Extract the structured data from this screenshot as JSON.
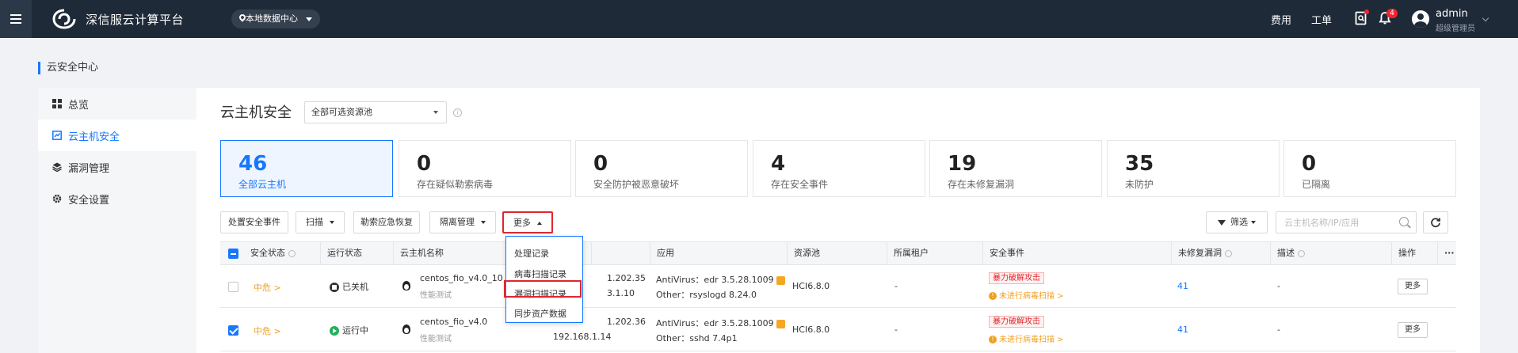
{
  "header": {
    "app_title": "深信服云计算平台",
    "datacenter": "本地数据中心",
    "links": {
      "cost": "费用",
      "ticket": "工单"
    },
    "notification_count": "4",
    "user": {
      "name": "admin",
      "role": "超级管理员"
    }
  },
  "breadcrumb": "云安全中心",
  "sidebar": {
    "items": [
      {
        "label": "总览",
        "icon": "grid-icon"
      },
      {
        "label": "云主机安全",
        "icon": "shield-host-icon",
        "active": true
      },
      {
        "label": "漏洞管理",
        "icon": "layers-icon"
      },
      {
        "label": "安全设置",
        "icon": "gear-icon"
      }
    ]
  },
  "main": {
    "title": "云主机安全",
    "pool_select": "全部可选资源池",
    "info": "i"
  },
  "stats": [
    {
      "value": "46",
      "label": "全部云主机",
      "active": true
    },
    {
      "value": "0",
      "label": "存在疑似勒索病毒"
    },
    {
      "value": "0",
      "label": "安全防护被恶意破坏"
    },
    {
      "value": "4",
      "label": "存在安全事件"
    },
    {
      "value": "19",
      "label": "存在未修复漏洞"
    },
    {
      "value": "35",
      "label": "未防护"
    },
    {
      "value": "0",
      "label": "已隔离"
    }
  ],
  "toolbar": {
    "handle_events": "处置安全事件",
    "scan": "扫描",
    "ransom_recovery": "勒索应急恢复",
    "isolation": "隔离管理",
    "more": "更多",
    "filter": "筛选",
    "search_placeholder": "云主机名称/IP/应用"
  },
  "more_menu": [
    "处理记录",
    "病毒扫描记录",
    "漏洞扫描记录",
    "同步资产数据"
  ],
  "table": {
    "columns": {
      "security_status": "安全状态",
      "run_status": "运行状态",
      "vm_name": "云主机名称",
      "app": "应用",
      "pool": "资源池",
      "tenant": "所属租户",
      "events": "安全事件",
      "vulns": "未修复漏洞",
      "desc": "描述",
      "ops": "操作",
      "ellipsis": "···"
    },
    "rows": [
      {
        "checked": false,
        "risk": "中危 >",
        "status": "已关机",
        "status_type": "off",
        "vm_name": "centos_fio_v4.0_10",
        "vm_sub": "性能测试",
        "ip1": "1.202.35",
        "ip2": "3.1.10",
        "app1": "AntiVirus：edr 3.5.28.1009",
        "app2": "Other：rsyslogd 8.24.0",
        "pool": "HCI6.8.0",
        "tenant": "-",
        "event_tag": "暴力破解攻击",
        "event_warn": "未进行病毒扫描 >",
        "vulns": "41",
        "desc": "-",
        "op": "更多"
      },
      {
        "checked": true,
        "risk": "中危 >",
        "status": "运行中",
        "status_type": "on",
        "vm_name": "centos_fio_v4.0",
        "vm_sub": "性能测试",
        "ip1": "1.202.36",
        "ip2": "192.168.1.14",
        "app1": "AntiVirus：edr 3.5.28.1009",
        "app2": "Other：sshd 7.4p1",
        "pool": "HCI6.8.0",
        "tenant": "-",
        "event_tag": "暴力破解攻击",
        "event_warn": "未进行病毒扫描 >",
        "vulns": "41",
        "desc": "-",
        "op": "更多"
      }
    ]
  },
  "colors": {
    "topbar": "#1f2a38",
    "accent": "#1677ff",
    "highlight": "#e0262d",
    "risk": "#f0a020",
    "running": "#21b05a"
  }
}
